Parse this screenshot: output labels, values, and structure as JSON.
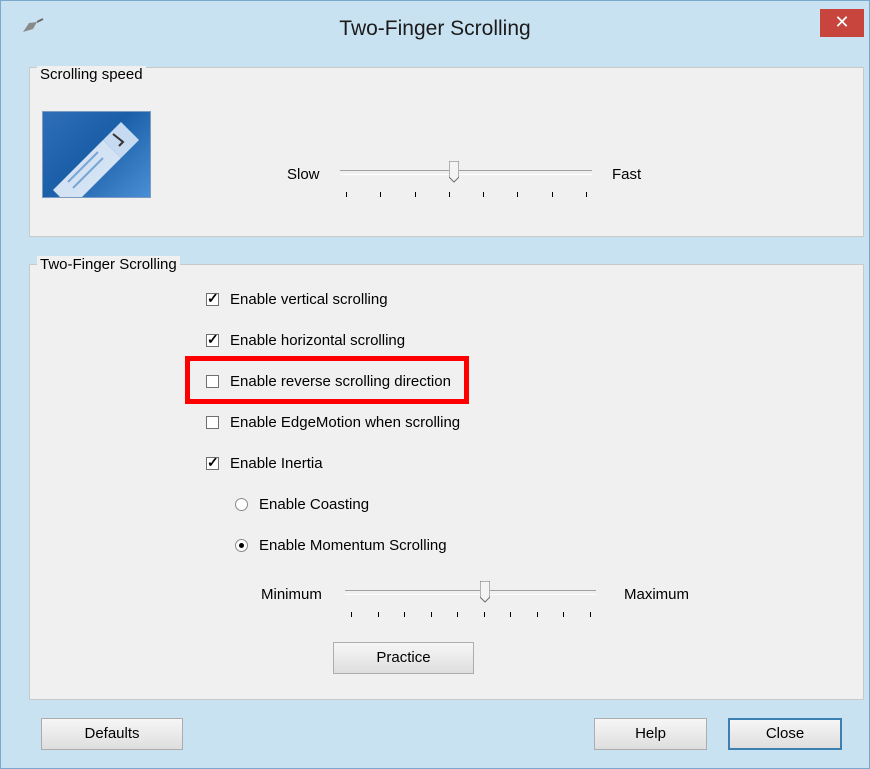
{
  "window": {
    "title": "Two-Finger Scrolling",
    "close_glyph": "✕"
  },
  "speed_group": {
    "legend": "Scrolling speed",
    "slow_label": "Slow",
    "fast_label": "Fast",
    "speed_value": 0.45
  },
  "scroll_group": {
    "legend": "Two-Finger Scrolling",
    "options": [
      {
        "label": "Enable vertical scrolling",
        "checked": true
      },
      {
        "label": "Enable horizontal scrolling",
        "checked": true
      },
      {
        "label": "Enable reverse scrolling direction",
        "checked": false
      },
      {
        "label": "Enable EdgeMotion when scrolling",
        "checked": false
      },
      {
        "label": "Enable Inertia",
        "checked": true
      }
    ],
    "inertia_modes": [
      {
        "label": "Enable Coasting",
        "selected": false
      },
      {
        "label": "Enable Momentum Scrolling",
        "selected": true
      }
    ],
    "min_label": "Minimum",
    "max_label": "Maximum",
    "momentum_value": 0.56,
    "practice_label": "Practice"
  },
  "footer": {
    "defaults_label": "Defaults",
    "help_label": "Help",
    "close_label": "Close"
  },
  "colors": {
    "title_bar": "#c9e2f2",
    "close_button": "#c7453c",
    "highlight": "#ff0000",
    "dialog_background": "#f0f0f0"
  }
}
